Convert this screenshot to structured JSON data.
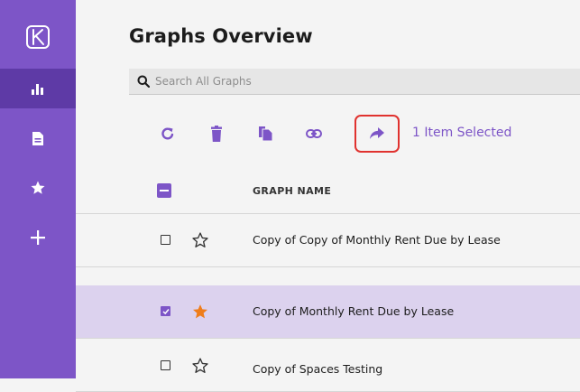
{
  "sidebar": {
    "items": [
      {
        "icon": "logo-icon"
      },
      {
        "icon": "bar-chart-icon",
        "active": true
      },
      {
        "icon": "document-icon"
      },
      {
        "icon": "star-icon"
      },
      {
        "icon": "plus-icon"
      }
    ]
  },
  "page": {
    "title": "Graphs Overview"
  },
  "search": {
    "placeholder": "Search All Graphs"
  },
  "toolbar": {
    "buttons": [
      {
        "icon": "refresh-icon"
      },
      {
        "icon": "trash-icon"
      },
      {
        "icon": "copy-icon"
      },
      {
        "icon": "link-icon"
      },
      {
        "icon": "share-arrow-icon",
        "highlighted": true
      }
    ],
    "selection_text": "1 Item Selected"
  },
  "table": {
    "header": {
      "name_label": "GRAPH NAME"
    },
    "rows": [
      {
        "name": "Copy of Copy of Monthly Rent Due by Lease",
        "checked": false,
        "starred": false
      },
      {
        "name": "Copy of Monthly Rent Due by Lease",
        "checked": true,
        "starred": true
      },
      {
        "name": "Copy of Spaces Testing",
        "checked": false,
        "starred": false
      }
    ]
  },
  "colors": {
    "brand": "#7d55c7",
    "brand_dark": "#5e3aa6",
    "selected_row": "#dcd2ee",
    "star_active": "#ef7d1a",
    "highlight_border": "#e0322f"
  }
}
